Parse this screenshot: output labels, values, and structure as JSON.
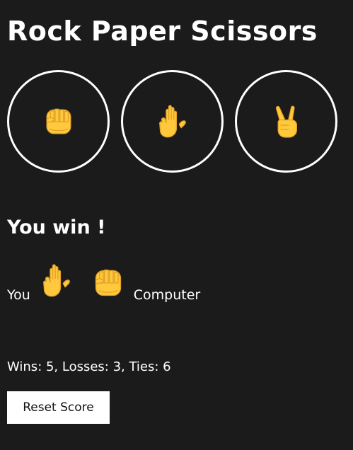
{
  "app": {
    "title": "Rock Paper Scissors"
  },
  "choices": [
    {
      "name": "rock",
      "icon": "raised-fist-icon"
    },
    {
      "name": "paper",
      "icon": "raised-hand-icon"
    },
    {
      "name": "scissors",
      "icon": "victory-hand-icon"
    }
  ],
  "result": {
    "text": "You win !",
    "player_label": "You",
    "player_choice_icon": "raised-hand-icon",
    "computer_choice_icon": "raised-fist-icon",
    "computer_label": "Computer"
  },
  "score": {
    "text": "Wins: 5, Losses: 3, Ties: 6",
    "wins": 5,
    "losses": 3,
    "ties": 6
  },
  "controls": {
    "reset_label": "Reset Score"
  },
  "colors": {
    "background": "#1b1b1b",
    "text": "#ffffff",
    "emoji": "#ffc83d"
  }
}
